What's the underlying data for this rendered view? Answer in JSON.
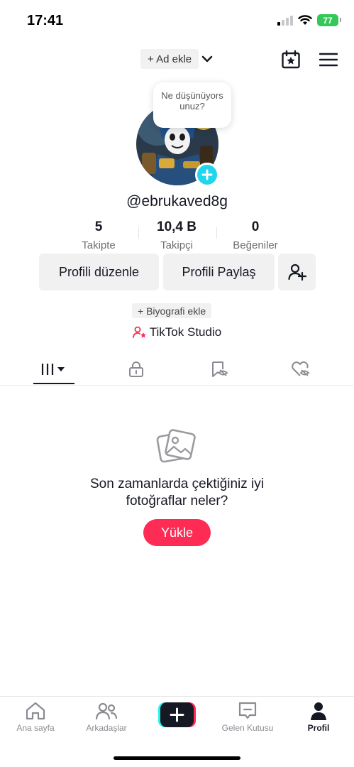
{
  "status": {
    "time": "17:41",
    "battery": "77"
  },
  "header": {
    "add_name": "+ Ad ekle"
  },
  "bubble": {
    "text": "Ne düşünüyorsunuz?"
  },
  "profile": {
    "username": "@ebrukaved8g"
  },
  "stats": [
    {
      "value": "5",
      "label": "Takipte"
    },
    {
      "value": "10,4 B",
      "label": "Takipçi"
    },
    {
      "value": "0",
      "label": "Beğeniler"
    }
  ],
  "buttons": {
    "edit": "Profili düzenle",
    "share": "Profili Paylaş"
  },
  "bio": {
    "add": "+ Biyografi ekle"
  },
  "studio": {
    "label": "TikTok Studio"
  },
  "empty": {
    "line1": "Son zamanlarda çektiğiniz iyi",
    "line2": "fotoğraflar neler?",
    "upload": "Yükle"
  },
  "nav": {
    "home": "Ana sayfa",
    "friends": "Arkadaşlar",
    "inbox": "Gelen Kutusu",
    "profile": "Profil"
  },
  "colors": {
    "accent": "#fe2c55",
    "cyan": "#20d5ec",
    "text": "#161823"
  }
}
